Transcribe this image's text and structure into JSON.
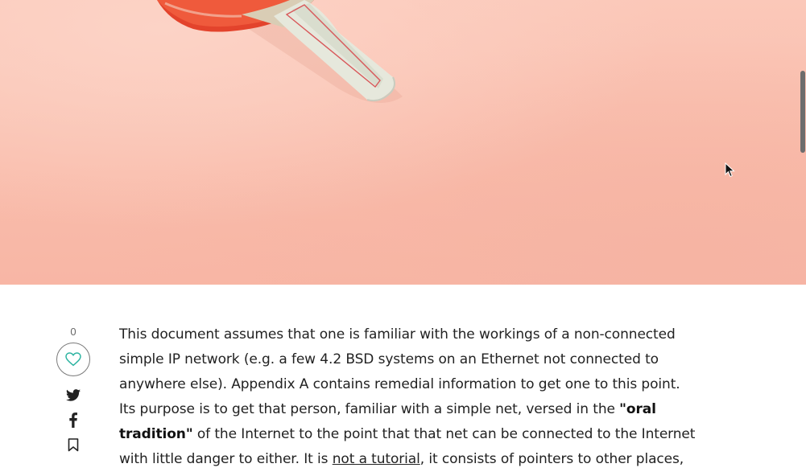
{
  "hero": {
    "image": "ping-pong-paddle-on-pink-background",
    "colors": {
      "background": "#fac3b4",
      "paddle_rubber": "#e4412b",
      "handle": "#dfe2d6"
    }
  },
  "social": {
    "like_count": "0",
    "icons": [
      "heart-icon",
      "twitter-icon",
      "facebook-icon",
      "bookmark-icon"
    ],
    "accent_color": "#2bb3a0"
  },
  "article": {
    "para1": "This document assumes that one is familiar with the workings of a non-connected simple IP network (e.g. a few 4.2 BSD systems on an Ethernet not connected to anywhere else). Appendix A contains remedial information to get one to this point. Its purpose is to get that person, familiar with a simple net, versed in the ",
    "bold_phrase": "\"oral tradition\"",
    "para2": " of the Internet to the point that that net can be connected to the Internet with little danger to either. It is ",
    "link_text": "not a tutorial",
    "para3": ", it consists of pointers to other places, literature,"
  }
}
